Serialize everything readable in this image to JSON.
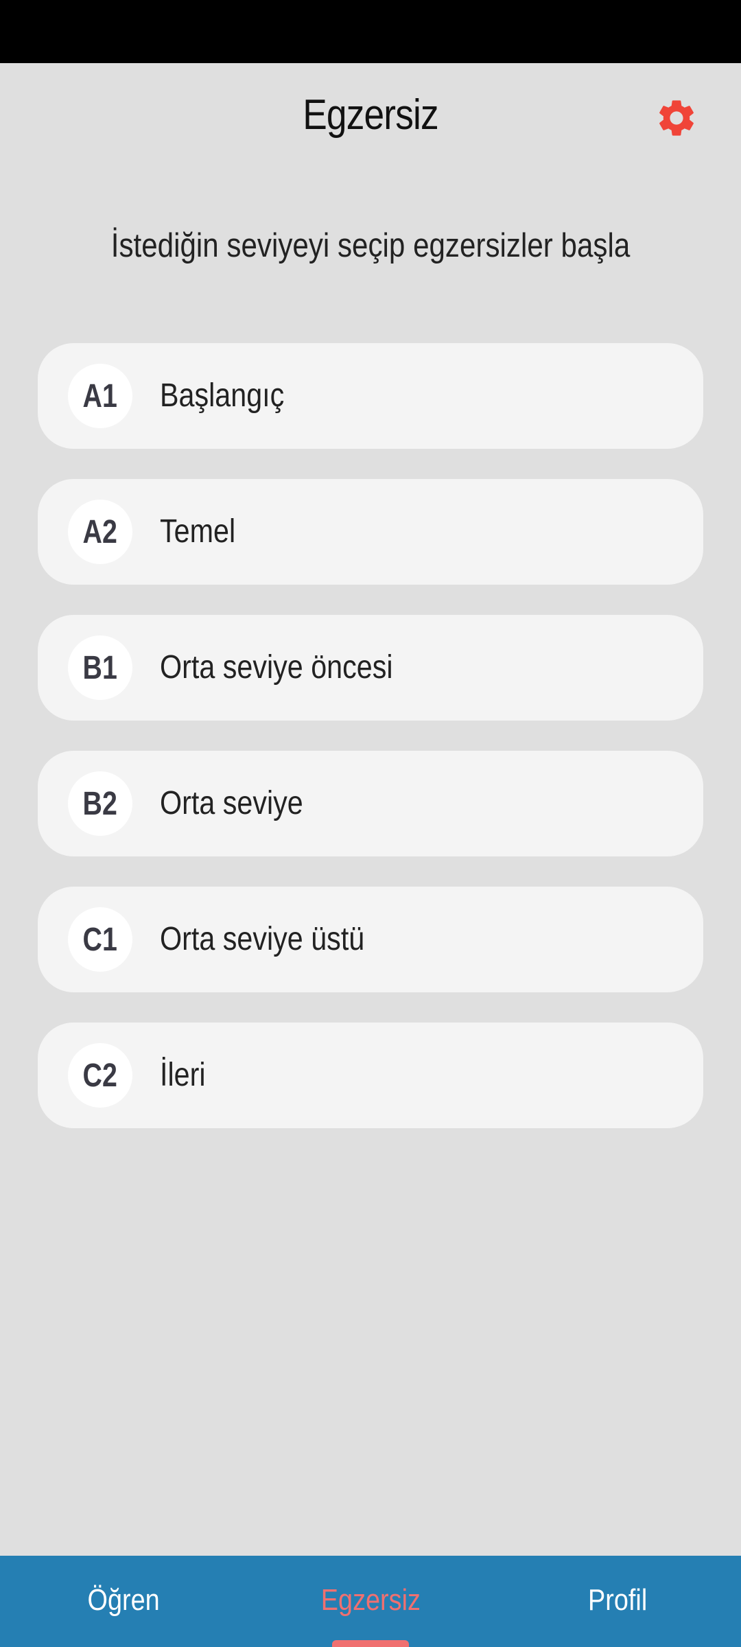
{
  "header": {
    "title": "Egzersiz",
    "settings_icon": "gear-icon",
    "settings_color": "#f04438"
  },
  "subtitle": "İstediğin seviyeyi seçip egzersizler başla",
  "levels": [
    {
      "code": "A1",
      "name": "Başlangıç"
    },
    {
      "code": "A2",
      "name": "Temel"
    },
    {
      "code": "B1",
      "name": "Orta seviye öncesi"
    },
    {
      "code": "B2",
      "name": "Orta seviye"
    },
    {
      "code": "C1",
      "name": "Orta seviye üstü"
    },
    {
      "code": "C2",
      "name": "İleri"
    }
  ],
  "bottom_nav": {
    "items": [
      {
        "label": "Öğren"
      },
      {
        "label": "Egzersiz",
        "active": true
      },
      {
        "label": "Profil"
      }
    ],
    "background": "#257fb3",
    "active_color": "#f07070"
  }
}
